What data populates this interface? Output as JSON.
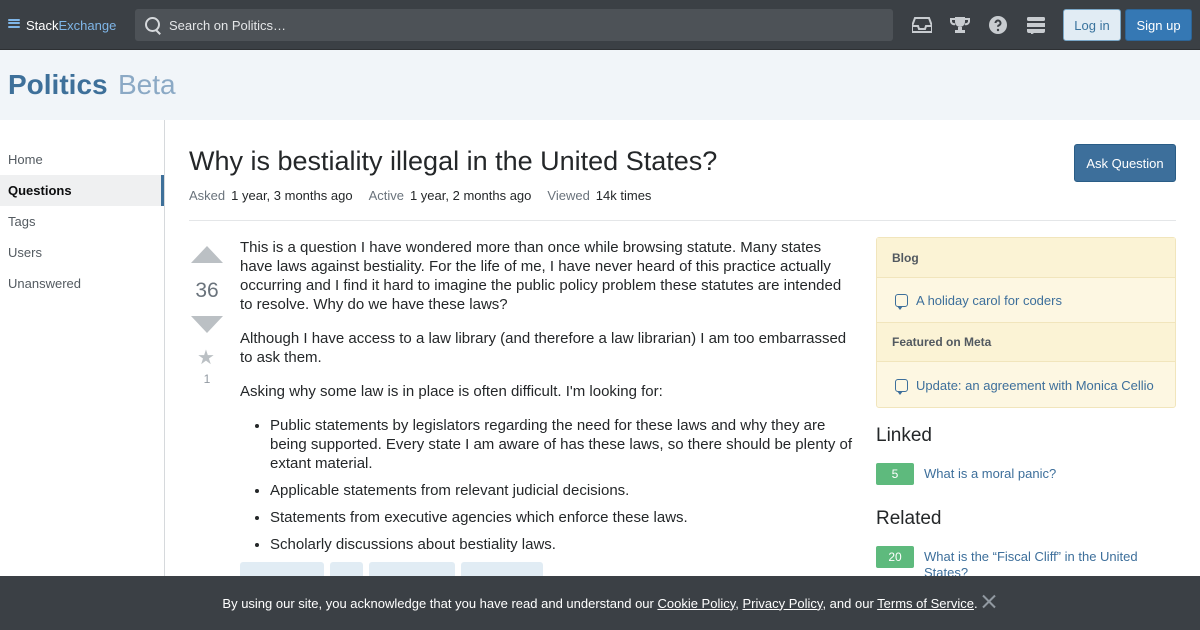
{
  "topbar": {
    "brand_part1": "Stack",
    "brand_part2": "Exchange",
    "search_placeholder": "Search on Politics…",
    "icons": [
      "inbox-icon",
      "trophy-icon",
      "help-icon",
      "site-switcher-icon"
    ],
    "login_label": "Log in",
    "signup_label": "Sign up"
  },
  "site": {
    "name": "Politics",
    "beta": "Beta"
  },
  "nav": {
    "items": [
      {
        "label": "Home"
      },
      {
        "label": "Questions",
        "active": true
      },
      {
        "label": "Tags"
      },
      {
        "label": "Users"
      },
      {
        "label": "Unanswered"
      }
    ]
  },
  "question": {
    "title": "Why is bestiality illegal in the United States?",
    "ask_button": "Ask Question",
    "asked_label": "Asked",
    "asked_value": "1 year, 3 months ago",
    "active_label": "Active",
    "active_value": "1 year, 2 months ago",
    "viewed_label": "Viewed",
    "viewed_value": "14k times",
    "votes": "36",
    "favorites": "1",
    "paragraphs": [
      "This is a question I have wondered more than once while browsing statute. Many states have laws against bestiality. For the life of me, I have never heard of this practice actually occurring and I find it hard to imagine the public policy problem these statutes are intended to resolve. Why do we have these laws?",
      "Although I have access to a law library (and therefore a law librarian) I am too embarrassed to ask them.",
      "Asking why some law is in place is often difficult. I'm looking for:"
    ],
    "bullets": [
      "Public statements by legislators regarding the need for these laws and why they are being supported. Every state I am aware of has these laws, so there should be plenty of extant material.",
      "Applicable statements from relevant judicial decisions.",
      "Statements from executive agencies which enforce these laws.",
      "Scholarly discussions about bestiality laws."
    ]
  },
  "sidebar": {
    "blog_heading": "Blog",
    "blog_item": "A holiday carol for coders",
    "meta_heading": "Featured on Meta",
    "meta_item": "Update: an agreement with Monica Cellio",
    "linked_heading": "Linked",
    "linked": [
      {
        "score": "5",
        "title": "What is a moral panic?"
      }
    ],
    "related_heading": "Related",
    "related": [
      {
        "score": "20",
        "title": "What is the “Fiscal Cliff” in the United States?"
      }
    ]
  },
  "cookie": {
    "text1": "By using our site, you acknowledge that you have read and understand our ",
    "cookie_policy": "Cookie Policy",
    "sep1": ", ",
    "privacy_policy": "Privacy Policy",
    "sep2": ", and our ",
    "terms": "Terms of Service",
    "end": "."
  },
  "colors": {
    "topbar": "#3b4045",
    "brand_blue": "#3e709a",
    "accepted_green": "#5eba7d"
  }
}
